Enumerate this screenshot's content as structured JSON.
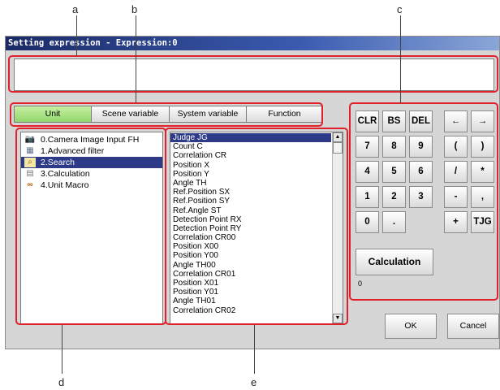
{
  "callouts": {
    "a": "a",
    "b": "b",
    "c": "c",
    "d": "d",
    "e": "e"
  },
  "window": {
    "title": "Setting expression - Expression:0",
    "expression_value": ""
  },
  "tabs": [
    {
      "label": "Unit",
      "active": true
    },
    {
      "label": "Scene variable",
      "active": false
    },
    {
      "label": "System variable",
      "active": false
    },
    {
      "label": "Function",
      "active": false
    }
  ],
  "unit_tree": [
    {
      "label": "0.Camera Image Input FH",
      "icon": "camera-icon",
      "selected": false
    },
    {
      "label": "1.Advanced filter",
      "icon": "filter-icon",
      "selected": false
    },
    {
      "label": "2.Search",
      "icon": "search-icon",
      "selected": true
    },
    {
      "label": "3.Calculation",
      "icon": "calculator-icon",
      "selected": false
    },
    {
      "label": "4.Unit Macro",
      "icon": "macro-icon",
      "selected": false
    }
  ],
  "variables": [
    "Judge JG",
    "Count C",
    "Correlation CR",
    "Position X",
    "Position Y",
    "Angle TH",
    "Ref.Position SX",
    "Ref.Position SY",
    "Ref.Angle ST",
    "Detection Point RX",
    "Detection Point RY",
    "Correlation CR00",
    "Position X00",
    "Position Y00",
    "Angle TH00",
    "Correlation CR01",
    "Position X01",
    "Position Y01",
    "Angle TH01",
    "Correlation CR02"
  ],
  "selected_variable": "Judge JG",
  "keypad": {
    "clr": "CLR",
    "bs": "BS",
    "del": "DEL",
    "left": "←",
    "right": "→",
    "k7": "7",
    "k8": "8",
    "k9": "9",
    "lparen": "(",
    "rparen": ")",
    "k4": "4",
    "k5": "5",
    "k6": "6",
    "divide": "/",
    "multiply": "*",
    "k1": "1",
    "k2": "2",
    "k3": "3",
    "minus": "-",
    "comma": ",",
    "k0": "0",
    "dot": ".",
    "plus": "+",
    "tjg": "TJG"
  },
  "calculation": {
    "button_label": "Calculation",
    "result": "0"
  },
  "footer": {
    "ok_label": "OK",
    "cancel_label": "Cancel"
  },
  "colors": {
    "highlight_box": "#e0202a",
    "selection": "#2c3a87",
    "active_tab": "#a8e07e"
  }
}
